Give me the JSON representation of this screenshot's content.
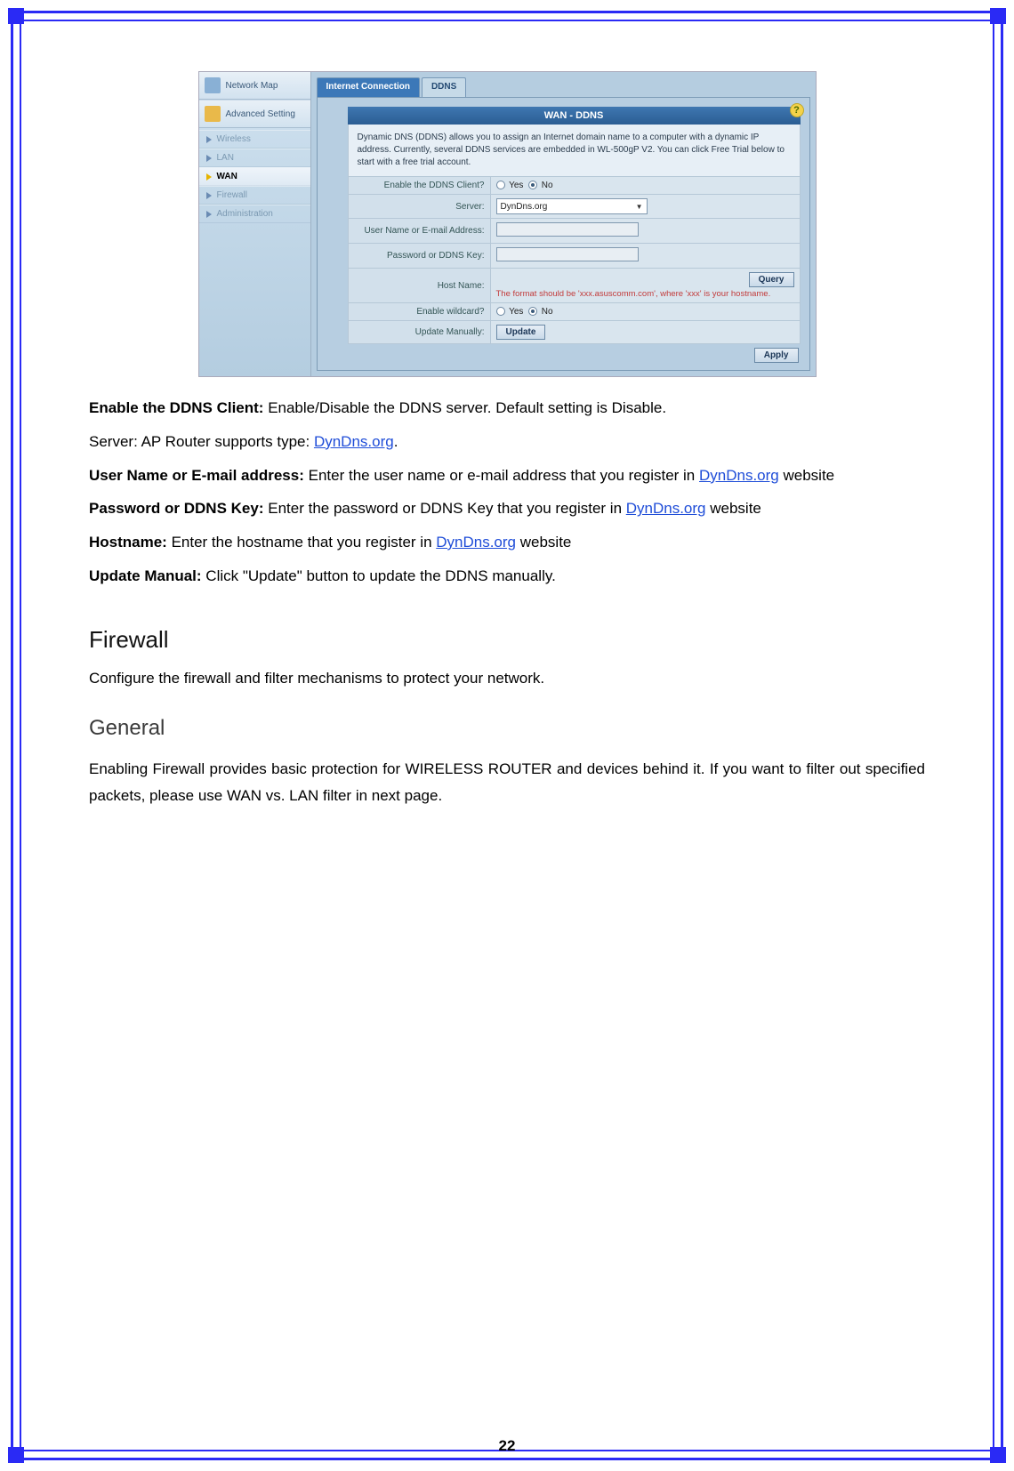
{
  "page_number": "22",
  "sidebar": {
    "top1": "Network Map",
    "top2": "Advanced Setting",
    "items": [
      "Wireless",
      "LAN",
      "WAN",
      "Firewall",
      "Administration"
    ],
    "active_index": 2
  },
  "tabs": {
    "inactive": "Internet Connection",
    "active": "DDNS"
  },
  "panel": {
    "title": "WAN - DDNS",
    "help_glyph": "?",
    "desc": "Dynamic DNS (DDNS) allows you to assign an Internet domain name to a computer with a dynamic IP address. Currently, several DDNS services are embedded in WL-500gP V2. You can click Free Trial below to start with a free trial account.",
    "rows": {
      "enable_label": "Enable the DDNS Client?",
      "yes": "Yes",
      "no": "No",
      "server_label": "Server:",
      "server_value": "DynDns.org",
      "user_label": "User Name or E-mail Address:",
      "pass_label": "Password or DDNS Key:",
      "host_label": "Host Name:",
      "host_hint": "The format should be 'xxx.asuscomm.com', where 'xxx' is your hostname.",
      "query": "Query",
      "wildcard_label": "Enable wildcard?",
      "manual_label": "Update Manually:",
      "update_btn": "Update",
      "apply": "Apply"
    }
  },
  "doc": {
    "p1_bold": "Enable the DDNS Client: ",
    "p1_rest": "Enable/Disable the DDNS server. Default setting is Disable.",
    "p2a": "Server: AP Router supports type: ",
    "link_dyn": "DynDns.org",
    "p2b": ".",
    "p3_bold": "User Name or E-mail address: ",
    "p3_a": "Enter the user name or e-mail address that you register in ",
    "p3_b": " website",
    "p4_bold": "Password or DDNS Key: ",
    "p4_a": "Enter the password or DDNS Key that you register in ",
    "p4_b": " website",
    "p5_bold": "Hostname: ",
    "p5_a": "Enter the hostname that you register in ",
    "p5_b": " website",
    "p6_bold": "Update Manual: ",
    "p6_rest": "Click \"Update\" button to update the DDNS manually.",
    "h_firewall": "Firewall",
    "firewall_desc": "Configure the firewall and filter mechanisms to protect your network.",
    "h_general": "General",
    "general_desc": "Enabling Firewall provides basic protection for WIRELESS ROUTER and devices behind it. If you want to filter out specified packets, please use WAN vs. LAN filter in next page."
  }
}
